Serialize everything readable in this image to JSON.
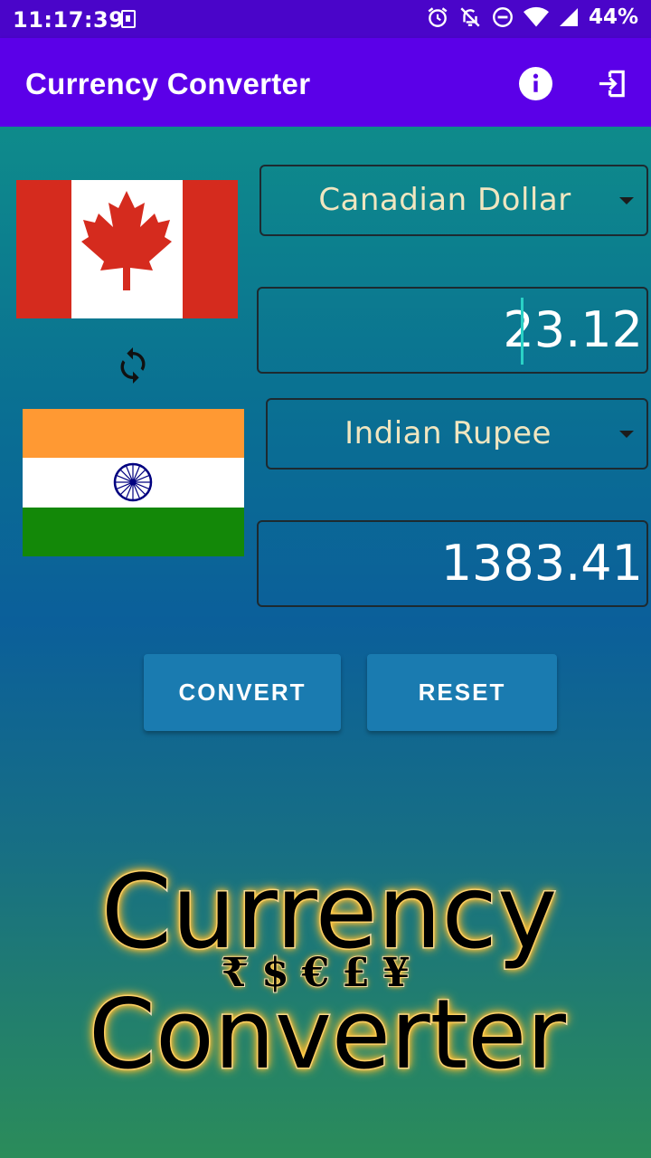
{
  "status_bar": {
    "time": "11:17:39",
    "battery": "44%"
  },
  "app_bar": {
    "title": "Currency Converter",
    "info_icon": "info-icon",
    "exit_icon": "exit-icon"
  },
  "from": {
    "currency": "Canadian Dollar",
    "amount": "23.12",
    "flag": "canada-flag"
  },
  "to": {
    "currency": "Indian Rupee",
    "amount": "1383.41",
    "flag": "india-flag"
  },
  "buttons": {
    "convert_label": "CONVERT",
    "reset_label": "RESET"
  },
  "logo": {
    "line1": "Currency",
    "symbols": "₹$€£¥",
    "line2": "Converter"
  },
  "colors": {
    "status_bar": "#4a05c9",
    "app_bar": "#5b00e8",
    "button": "#1a7bb0",
    "dropdown_text": "#f0e6c0"
  }
}
